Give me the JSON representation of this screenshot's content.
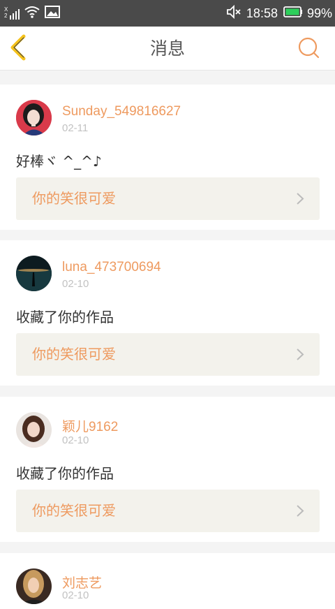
{
  "status_bar": {
    "signal_label": "X 2",
    "time": "18:58",
    "battery": "99%",
    "icons": [
      "signal-icon",
      "wifi-icon",
      "image-icon",
      "mute-icon",
      "battery-icon"
    ]
  },
  "header": {
    "title": "消息",
    "back_icon": "chevron-left-icon",
    "search_icon": "search-icon"
  },
  "colors": {
    "accent": "#ee9a5f",
    "back_yellow": "#f5c21b",
    "quote_bg": "#f3f2ec",
    "status_bar_bg": "#4a4a4a",
    "page_bg": "#f4f4f4"
  },
  "messages": [
    {
      "username": "Sunday_549816627",
      "date": "02-11",
      "text": "好棒ヾ ^_^♪",
      "quote": "你的笑很可爱"
    },
    {
      "username": "luna_473700694",
      "date": "02-10",
      "text": "收藏了你的作品",
      "quote": "你的笑很可爱"
    },
    {
      "username": "颖儿9162",
      "date": "02-10",
      "text": "收藏了你的作品",
      "quote": "你的笑很可爱"
    },
    {
      "username": "刘志艺",
      "date": "02-10"
    }
  ]
}
